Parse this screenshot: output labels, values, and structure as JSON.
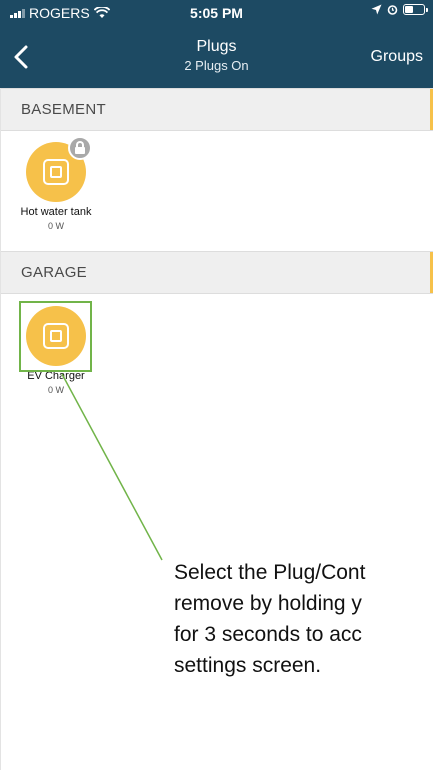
{
  "status_bar": {
    "carrier": "ROGERS",
    "time": "5:05 PM",
    "icons": [
      "signal-icon",
      "wifi-icon",
      "location-icon",
      "alarm-icon",
      "battery-icon"
    ]
  },
  "nav": {
    "title": "Plugs",
    "subtitle": "2 Plugs On",
    "groups_label": "Groups"
  },
  "sections": [
    {
      "label": "BASEMENT",
      "plugs": [
        {
          "name": "Hot water tank",
          "power": "0 W",
          "locked": true
        }
      ]
    },
    {
      "label": "GARAGE",
      "plugs": [
        {
          "name": "EV Charger",
          "power": "0 W",
          "locked": false
        }
      ]
    }
  ],
  "callout": {
    "lines": [
      "Select the Plug/Cont",
      "remove by holding y",
      "for 3 seconds to acc",
      "settings screen."
    ]
  },
  "colors": {
    "header_bg": "#1d4a63",
    "plug_on": "#f6c14a",
    "highlight": "#71b449",
    "section_bg": "#efefef"
  }
}
